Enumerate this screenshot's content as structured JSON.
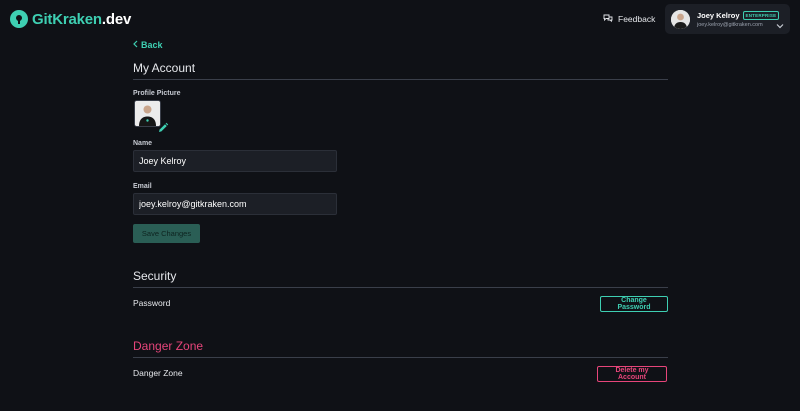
{
  "header": {
    "logo_brand": "GitKraken",
    "logo_tld": ".dev",
    "feedback_label": "Feedback",
    "user": {
      "name": "Joey Kelroy",
      "badge": "ENTERPRISE",
      "email": "joey.kelroy@gitkraken.com"
    }
  },
  "back_label": "Back",
  "account": {
    "title": "My Account",
    "profile_picture_label": "Profile Picture",
    "name_label": "Name",
    "name_value": "Joey Kelroy",
    "email_label": "Email",
    "email_value": "joey.kelroy@gitkraken.com",
    "save_label": "Save Changes"
  },
  "security": {
    "title": "Security",
    "password_label": "Password",
    "change_password_label": "Change Password"
  },
  "danger": {
    "title": "Danger Zone",
    "row_label": "Danger Zone",
    "delete_label": "Delete my Account"
  },
  "colors": {
    "background": "#0f1116",
    "accent": "#3ecfb2",
    "danger": "#e6457a",
    "input_bg": "#1c1f26"
  },
  "icons": {
    "logo": "gitkraken-logo-icon",
    "feedback": "chat-bubbles-icon",
    "chevron": "chevron-down-icon",
    "back": "chevron-left-icon",
    "edit": "pencil-icon"
  }
}
